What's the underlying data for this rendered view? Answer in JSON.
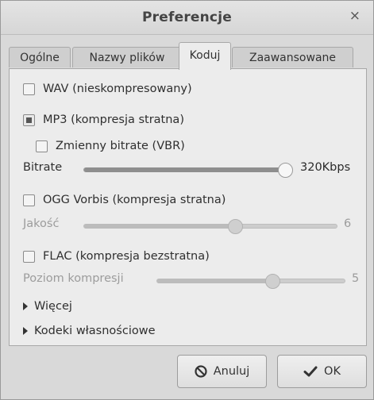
{
  "window": {
    "title": "Preferencje",
    "close_glyph": "×"
  },
  "tabs": [
    {
      "label": "Ogólne",
      "active": false
    },
    {
      "label": "Nazwy plików",
      "active": false
    },
    {
      "label": "Koduj",
      "active": true
    },
    {
      "label": "Zaawansowane",
      "active": false
    }
  ],
  "formats": {
    "wav": {
      "label": "WAV (nieskompresowany)",
      "checked": false
    },
    "mp3": {
      "label": "MP3 (kompresja stratna)",
      "checked": true
    },
    "vbr": {
      "label": "Zmienny bitrate (VBR)",
      "checked": false
    },
    "bitrate": {
      "label": "Bitrate",
      "value": "320Kbps",
      "fraction": 1.0
    },
    "ogg": {
      "label": "OGG Vorbis (kompresja stratna)",
      "checked": false
    },
    "quality": {
      "label": "Jakość",
      "value": "6",
      "fraction": 0.6
    },
    "flac": {
      "label": "FLAC (kompresja bezstratna)",
      "checked": false
    },
    "compression": {
      "label": "Poziom kompresji",
      "value": "5",
      "fraction": 0.62
    }
  },
  "expanders": {
    "more": "Więcej",
    "codecs": "Kodeki własnościowe"
  },
  "buttons": {
    "cancel": "Anuluj",
    "ok": "OK"
  },
  "icons": {
    "cancel": "cancel-circle-icon",
    "ok": "checkmark-icon",
    "expander": "triangle-right-icon"
  }
}
